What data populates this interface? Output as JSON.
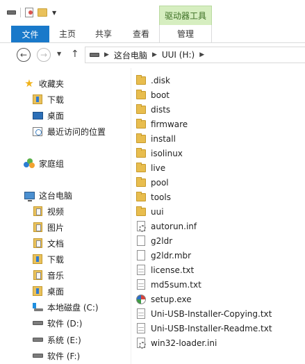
{
  "ribbon": {
    "context_group": "驱动器工具",
    "tabs": [
      "文件",
      "主页",
      "共享",
      "查看",
      "管理"
    ]
  },
  "address": {
    "path": [
      "这台电脑",
      "UUI (H:)"
    ]
  },
  "sidebar": {
    "favorites": "收藏夹",
    "fav_items": [
      "下载",
      "桌面",
      "最近访问的位置"
    ],
    "homegroup": "家庭组",
    "thispc": "这台电脑",
    "pc_items": [
      "视频",
      "图片",
      "文档",
      "下载",
      "音乐",
      "桌面"
    ],
    "drives": [
      "本地磁盘 (C:)",
      "软件 (D:)",
      "系统 (E:)",
      "软件 (F:)"
    ]
  },
  "files": [
    {
      "name": ".disk",
      "icon": "folder-icon"
    },
    {
      "name": "boot",
      "icon": "folder-icon"
    },
    {
      "name": "dists",
      "icon": "folder-icon"
    },
    {
      "name": "firmware",
      "icon": "folder-icon"
    },
    {
      "name": "install",
      "icon": "folder-icon"
    },
    {
      "name": "isolinux",
      "icon": "folder-icon"
    },
    {
      "name": "live",
      "icon": "folder-icon"
    },
    {
      "name": "pool",
      "icon": "folder-icon"
    },
    {
      "name": "tools",
      "icon": "folder-icon"
    },
    {
      "name": "uui",
      "icon": "folder-icon"
    },
    {
      "name": "autorun.inf",
      "icon": "settings-file-icon"
    },
    {
      "name": "g2ldr",
      "icon": "blank-file-icon"
    },
    {
      "name": "g2ldr.mbr",
      "icon": "blank-file-icon"
    },
    {
      "name": "license.txt",
      "icon": "text-file-icon"
    },
    {
      "name": "md5sum.txt",
      "icon": "text-file-icon"
    },
    {
      "name": "setup.exe",
      "icon": "exe-icon"
    },
    {
      "name": "Uni-USB-Installer-Copying.txt",
      "icon": "text-file-icon"
    },
    {
      "name": "Uni-USB-Installer-Readme.txt",
      "icon": "text-file-icon"
    },
    {
      "name": "win32-loader.ini",
      "icon": "settings-file-icon"
    }
  ],
  "colors": {
    "file_tab": "#1979ca",
    "context_tab": "#d6eec0",
    "folder": "#e8bd4e"
  }
}
